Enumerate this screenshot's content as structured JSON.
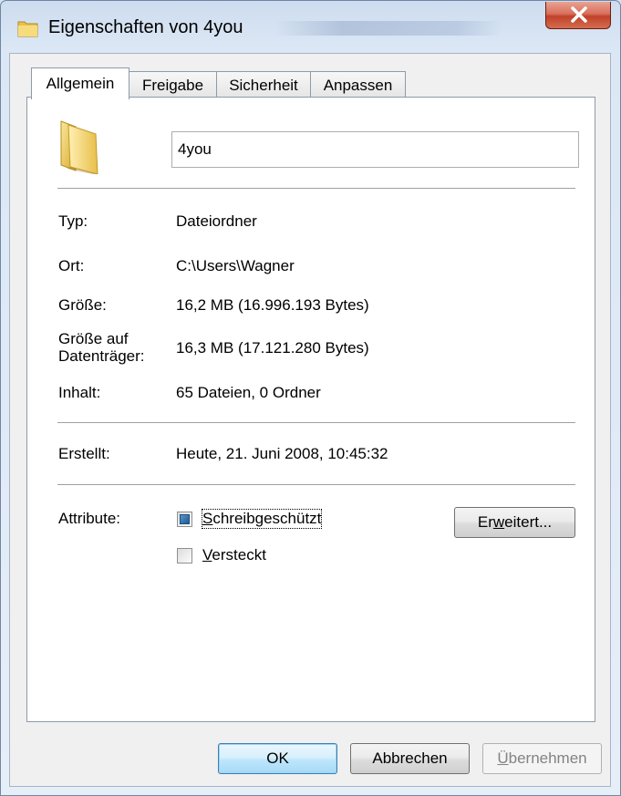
{
  "window": {
    "title": "Eigenschaften von 4you",
    "close_glyph": "X",
    "accent": "#c0412a"
  },
  "tabs": [
    {
      "label": "Allgemein",
      "active": true
    },
    {
      "label": "Freigabe",
      "active": false
    },
    {
      "label": "Sicherheit",
      "active": false
    },
    {
      "label": "Anpassen",
      "active": false
    }
  ],
  "general": {
    "folder_icon": "folder-icon",
    "name_value": "4you",
    "properties": [
      {
        "label": "Typ:",
        "value": "Dateiordner"
      },
      {
        "label": "Ort:",
        "value": "C:\\Users\\Wagner"
      },
      {
        "label": "Größe:",
        "value": "16,2 MB (16.996.193 Bytes)"
      },
      {
        "label": "Größe auf Datenträger:",
        "label_line1": "Größe auf",
        "label_line2": "Datenträger:",
        "value": "16,3 MB (17.121.280 Bytes)"
      },
      {
        "label": "Inhalt:",
        "value": "65 Dateien, 0 Ordner"
      }
    ],
    "created_label": "Erstellt:",
    "created_value": "Heute, 21. Juni 2008, 10:45:32",
    "attributes_label": "Attribute:",
    "readonly": {
      "pre": "",
      "u": "S",
      "post": "chreibgeschützt",
      "state": "indeterminate"
    },
    "hidden": {
      "pre": "",
      "u": "V",
      "post": "ersteckt",
      "state": "unchecked"
    },
    "advanced": {
      "pre": "Er",
      "u": "w",
      "post": "eitert..."
    }
  },
  "footer": {
    "ok": "OK",
    "cancel": "Abbrechen",
    "apply": {
      "pre": "",
      "u": "Ü",
      "post": "bernehmen",
      "enabled": false
    }
  }
}
